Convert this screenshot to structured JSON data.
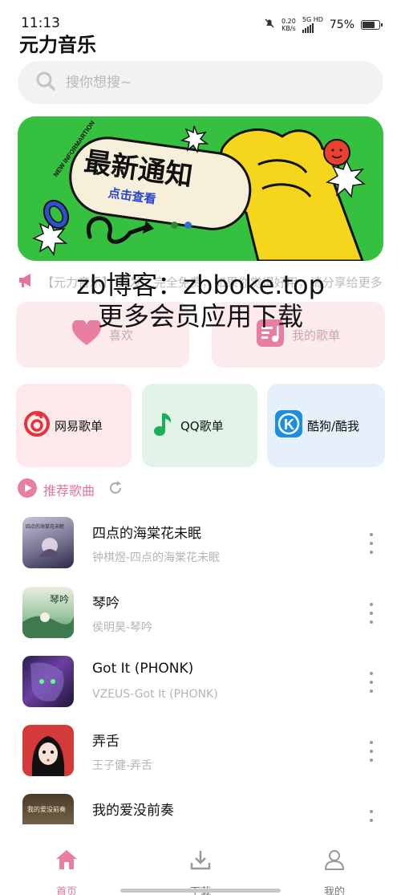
{
  "status": {
    "time": "11:13",
    "net_speed": "0.20",
    "net_unit": "KB/s",
    "net_type": "5G HD",
    "battery": "75%"
  },
  "app": {
    "title": "元力音乐"
  },
  "search": {
    "placeholder": "搜你想搜~"
  },
  "banner": {
    "headline": "最新通知",
    "sub": "点击查看",
    "tag": "NEW INFORMARTION",
    "dots": 2,
    "active_dot": 1
  },
  "notice": {
    "text": "【元力音乐】 开发，完全免费，如果你觉得好用，请分享给更多人，谢谢支持…"
  },
  "watermark": {
    "line1": "zb博客：zbboke.top",
    "line2": "更多会员应用下载"
  },
  "quick": {
    "like": "喜欢",
    "my_playlist": "我的歌单"
  },
  "sources": {
    "netease": "网易歌单",
    "qq": "QQ歌单",
    "kugou": "酷狗/酷我"
  },
  "recommend": {
    "label": "推荐歌曲"
  },
  "songs": [
    {
      "title": "四点的海棠花未眠",
      "subtitle": "钟棋煜-四点的海棠花未眠",
      "cover_text": "四点的海棠花未眠"
    },
    {
      "title": "琴吟",
      "subtitle": "侯明昊-琴吟",
      "cover_text": "琴吟"
    },
    {
      "title": "Got It (PHONK)",
      "subtitle": "VZEUS-Got It (PHONK)",
      "cover_text": ""
    },
    {
      "title": "弄舌",
      "subtitle": "王子健-弄舌",
      "cover_text": ""
    },
    {
      "title": "我的爱没前奏",
      "subtitle": "",
      "cover_text": "我的爱没前奏"
    }
  ],
  "nav": {
    "home": "首页",
    "download": "下载",
    "mine": "我的"
  },
  "colors": {
    "accent": "#e5739d",
    "banner_bg": "#35c03f",
    "banner_yellow": "#f6d61c"
  }
}
